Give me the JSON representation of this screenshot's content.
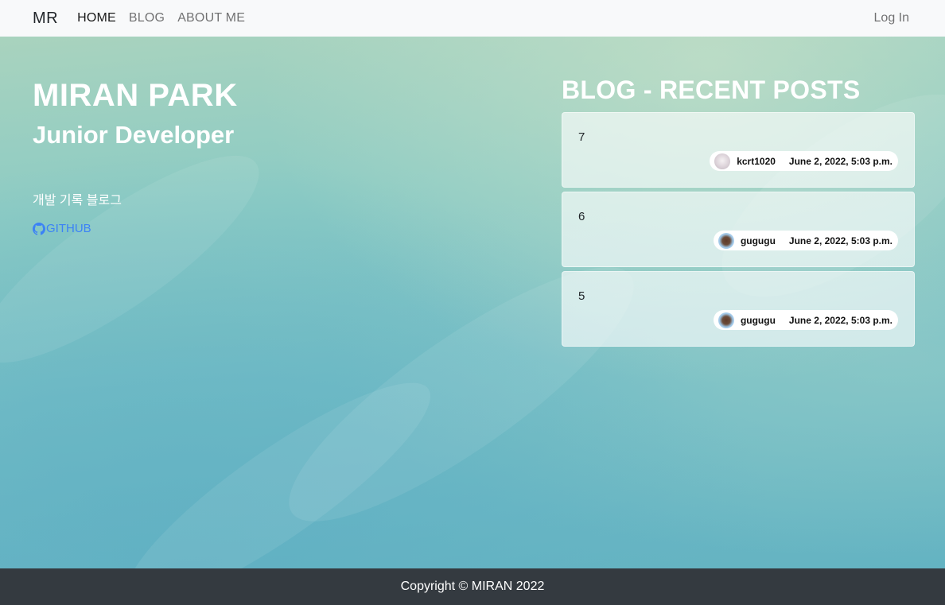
{
  "navbar": {
    "brand": "MR",
    "links": [
      {
        "label": "HOME",
        "active": true
      },
      {
        "label": "BLOG",
        "active": false
      },
      {
        "label": "ABOUT ME",
        "active": false
      }
    ],
    "login_label": "Log In"
  },
  "intro": {
    "name": "MIRAN PARK",
    "role": "Junior Developer",
    "description": "개발 기록 블로그",
    "github_label": "GITHUB",
    "github_icon": "github-icon"
  },
  "recent_posts": {
    "title": "BLOG - RECENT POSTS",
    "posts": [
      {
        "title": "7",
        "author": "kcrt1020",
        "date": "June 2, 2022, 5:03 p.m.",
        "avatar": "avatar-icon"
      },
      {
        "title": "6",
        "author": "gugugu",
        "date": "June 2, 2022, 5:03 p.m.",
        "avatar": "avatar-icon"
      },
      {
        "title": "5",
        "author": "gugugu",
        "date": "June 2, 2022, 5:03 p.m.",
        "avatar": "avatar-icon"
      }
    ]
  },
  "footer": {
    "copyright": "Copyright © MIRAN 2022"
  },
  "colors": {
    "navbar_bg": "#f8f9fa",
    "footer_bg": "#343a40",
    "link_blue": "#3b82f6"
  }
}
